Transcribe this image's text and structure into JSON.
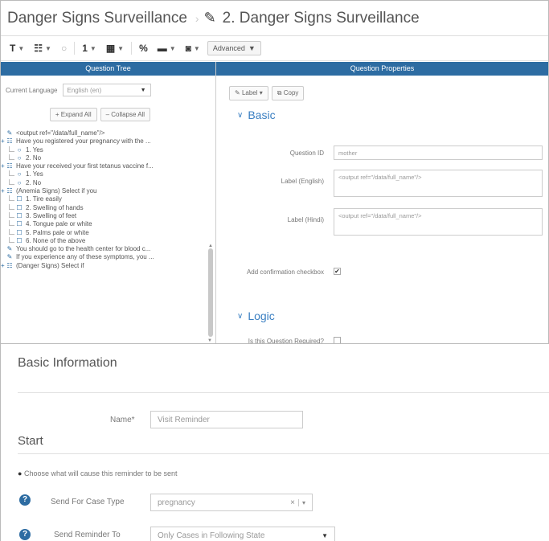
{
  "titlebar": {
    "app_title": "Danger Signs Surveillance",
    "form_title": "2. Danger Signs Surveillance"
  },
  "toolbar": {
    "items": [
      {
        "icon": "text-icon",
        "glyph": "T"
      },
      {
        "icon": "multiselect-icon",
        "glyph": "☷"
      },
      {
        "icon": "radio-icon",
        "glyph": "○"
      },
      {
        "icon": "number-icon",
        "glyph": "1"
      },
      {
        "icon": "calendar-icon",
        "glyph": "▦"
      },
      {
        "icon": "calculate-icon",
        "glyph": "%"
      },
      {
        "icon": "folder-icon",
        "glyph": "▬"
      },
      {
        "icon": "camera-icon",
        "glyph": "◙"
      }
    ],
    "advanced_label": "Advanced"
  },
  "tree": {
    "header": "Question Tree",
    "language_label": "Current Language",
    "language_value": "English (en)",
    "expand_label": "+ Expand All",
    "collapse_label": "– Collapse All",
    "items": [
      {
        "level": 0,
        "icon": "label-icon",
        "text": "<output ref=\"/data/full_name\"/>"
      },
      {
        "level": 0,
        "icon": "list-icon",
        "text": "Have you registered your pregnancy with the ..."
      },
      {
        "level": 1,
        "icon": "option-icon",
        "text": "1. Yes"
      },
      {
        "level": 1,
        "icon": "option-icon",
        "text": "2. No"
      },
      {
        "level": 0,
        "icon": "list-icon",
        "text": "Have your received your first tetanus vaccine f..."
      },
      {
        "level": 1,
        "icon": "option-icon",
        "text": "1. Yes"
      },
      {
        "level": 1,
        "icon": "option-icon",
        "text": "2. No"
      },
      {
        "level": 0,
        "icon": "list-icon",
        "text": "(Anemia Signs) Select if you"
      },
      {
        "level": 1,
        "icon": "checkbox-icon",
        "text": "1. Tire easily"
      },
      {
        "level": 1,
        "icon": "checkbox-icon",
        "text": "2. Swelling of hands"
      },
      {
        "level": 1,
        "icon": "checkbox-icon",
        "text": "3. Swelling of feet"
      },
      {
        "level": 1,
        "icon": "checkbox-icon",
        "text": "4. Tongue pale or white"
      },
      {
        "level": 1,
        "icon": "checkbox-icon",
        "text": "5. Palms pale or white"
      },
      {
        "level": 1,
        "icon": "checkbox-icon",
        "text": "6. None of the above"
      },
      {
        "level": 0,
        "icon": "label-icon",
        "text": "You should go to the health center for blood c..."
      },
      {
        "level": 0,
        "icon": "label-icon",
        "text": "If you experience any of these symptoms, you ..."
      },
      {
        "level": 0,
        "icon": "list-icon",
        "text": "(Danger Signs) Select if"
      }
    ]
  },
  "props": {
    "header": "Question Properties",
    "label_btn": "Label",
    "copy_btn": "Copy",
    "basic_title": "Basic",
    "question_id_label": "Question ID",
    "question_id_value": "mother",
    "label_english_label": "Label (English)",
    "label_english_value": "<output ref=\"/data/full_name\"/>",
    "label_hindi_label": "Label (Hindi)",
    "label_hindi_value": "<output ref=\"/data/full_name\"/>",
    "confirm_label": "Add confirmation checkbox",
    "confirm_checked": "✔",
    "logic_title": "Logic",
    "required_label": "Is this Question Required?"
  },
  "reminder": {
    "basic_title": "Basic Information",
    "name_label": "Name*",
    "name_value": "Visit Reminder",
    "start_title": "Start",
    "choose_note": "Choose what will cause this reminder to be sent",
    "case_type_label": "Send For Case Type",
    "case_type_value": "pregnancy",
    "send_to_label": "Send Reminder To",
    "send_to_value": "Only Cases in Following State"
  }
}
